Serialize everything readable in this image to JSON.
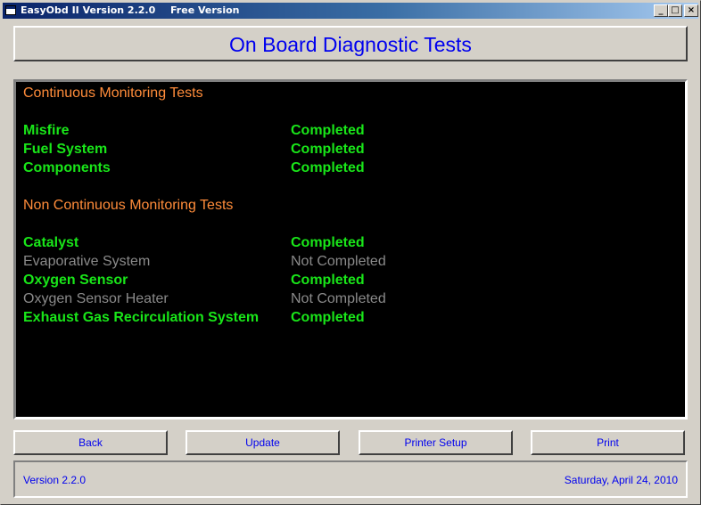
{
  "window": {
    "title": "EasyObd II Version 2.2.0",
    "edition": "Free Version",
    "controls": {
      "minimize": "_",
      "maximize": "□",
      "close": "×"
    }
  },
  "header": {
    "title": "On Board Diagnostic Tests"
  },
  "monitor": {
    "continuous_title": "Continuous Monitoring Tests",
    "continuous_tests": [
      {
        "name": "Misfire",
        "status": "Completed"
      },
      {
        "name": "Fuel System",
        "status": "Completed"
      },
      {
        "name": "Components",
        "status": "Completed"
      }
    ],
    "non_continuous_title": "Non Continuous Monitoring Tests",
    "non_continuous_tests": [
      {
        "name": "Catalyst",
        "status": "Completed"
      },
      {
        "name": "Evaporative System",
        "status": "Not Completed"
      },
      {
        "name": "Oxygen Sensor",
        "status": "Completed"
      },
      {
        "name": "Oxygen Sensor Heater",
        "status": "Not Completed"
      },
      {
        "name": "Exhaust Gas Recirculation System",
        "status": "Completed"
      }
    ],
    "colors": {
      "section": "#ff8c3a",
      "completed": "#19e619",
      "not_completed": "#8a8a8a"
    }
  },
  "buttons": {
    "back": "Back",
    "update": "Update",
    "printer_setup": "Printer Setup",
    "print": "Print"
  },
  "status_bar": {
    "version": "Version 2.2.0",
    "date": "Saturday, April 24, 2010"
  }
}
